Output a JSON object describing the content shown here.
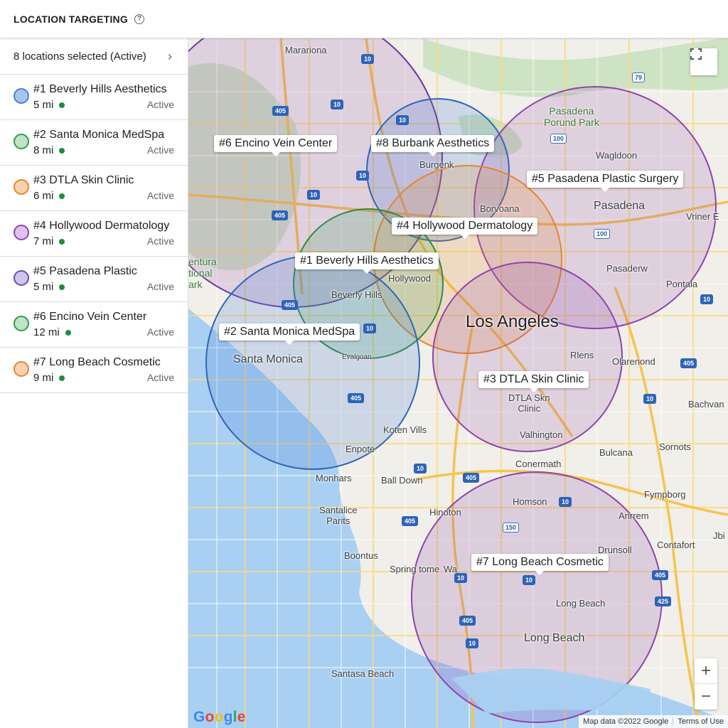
{
  "header": {
    "title": "LOCATION TARGETING",
    "help_icon": "?"
  },
  "sidebar": {
    "summary": "8 locations selected (Active)",
    "chevron": "›",
    "status_color": "#1e8e3e",
    "locations": [
      {
        "name": "#1 Beverly Hills Aesthetics",
        "radius": "5 mi",
        "status": "Active",
        "color": "#4a7fd4",
        "fill": "#a8c4ee"
      },
      {
        "name": "#2 Santa Monica MedSpa",
        "radius": "8 mi",
        "status": "Active",
        "color": "#2e9d4e",
        "fill": "#bfe3c7"
      },
      {
        "name": "#3 DTLA Skin Clinic",
        "radius": "6 mi",
        "status": "Active",
        "color": "#e8852b",
        "fill": "#f7d2b0"
      },
      {
        "name": "#4 Hollywood Dermatology",
        "radius": "7 mi",
        "status": "Active",
        "color": "#8e44ad",
        "fill": "#dcc3ec"
      },
      {
        "name": "#5 Pasadena Plastic",
        "radius": "5 mi",
        "status": "Active",
        "color": "#6a4fb0",
        "fill": "#cfc4ec"
      },
      {
        "name": "#6 Encino Vein Center",
        "radius": "12 mi",
        "status": "Active",
        "color": "#2e9d4e",
        "fill": "#bfe3c7"
      },
      {
        "name": "#7 Long Beach Cosmetic",
        "radius": "9 mi",
        "status": "Active",
        "color": "#e8852b",
        "fill": "#f7d2b0"
      }
    ]
  },
  "map": {
    "markers": [
      {
        "label": "#6 Encino Vein Center"
      },
      {
        "label": "#8 Burbank Aesthetics"
      },
      {
        "label": "#5 Pasadena Plastic Surgery"
      },
      {
        "label": "#4 Hollywood Dermatology"
      },
      {
        "label": "#1 Beverly Hills Aesthetics"
      },
      {
        "label": "#2 Santa Monica MedSpa"
      },
      {
        "label": "#3 DTLA Skin Clinic"
      },
      {
        "label": "#7 Long Beach Cosmetic"
      }
    ],
    "places": {
      "mararions": "Marariona",
      "pasadena_park": "Pasadena\nPorund Park",
      "wagldoon": "Wagldoon",
      "burgenk": "Burgenk",
      "borvoana": "Borvoana",
      "pasadena": "Pasadena",
      "vriner": "Vriner E",
      "hollywood": "Hollywood",
      "beverly_hills": "Beverly Hills",
      "pasaderw": "Pasaderw",
      "pontala": "Pontala",
      "ventura": "entura\ntional\nark",
      "los_angeles": "Los Angeles",
      "rlens": "Rlens",
      "olarenond": "Olarenond",
      "santa_monica": "Santa Monica",
      "evalgoan": "Evalgoan",
      "dtla_skn": "DTLA Skn\nClinic",
      "bachvan": "Bachvan",
      "valhington": "Valhington",
      "koten_vills": "Koten Vills",
      "enpote": "Enpote",
      "bulcana": "Bulcana",
      "sornots": "Sornots",
      "conermath": "Conermath",
      "monhars": "Monhars",
      "ball_down": "Ball Down",
      "fympborg": "Fympborg",
      "homson": "Homson",
      "santalice": "Santalice\nParits",
      "hinoton": "Hinoton",
      "anrrem": "Anrrem",
      "jbi": "Jbi",
      "contafort": "Contafort",
      "boontus": "Boontus",
      "drunsoll": "Drunsoll",
      "springtome": "Spring tome",
      "wa": "Wa",
      "long_beach_small": "Long Beach",
      "long_beach": "Long Beach",
      "santasa_beach": "Santasa Beach"
    },
    "shields": [
      "10",
      "79",
      "10",
      "405",
      "10",
      "100",
      "10",
      "10",
      "405",
      "100",
      "10",
      "405",
      "10",
      "405",
      "10",
      "405",
      "10",
      "10",
      "405",
      "405",
      "10",
      "150",
      "10",
      "405",
      "405",
      "10",
      "425",
      "405",
      "10"
    ],
    "fullscreen_icon": "⛶",
    "zoom_in": "+",
    "zoom_out": "−",
    "google_logo": "Google",
    "attribution": "Map data ©2022 Google",
    "terms": "Terms of Use"
  }
}
